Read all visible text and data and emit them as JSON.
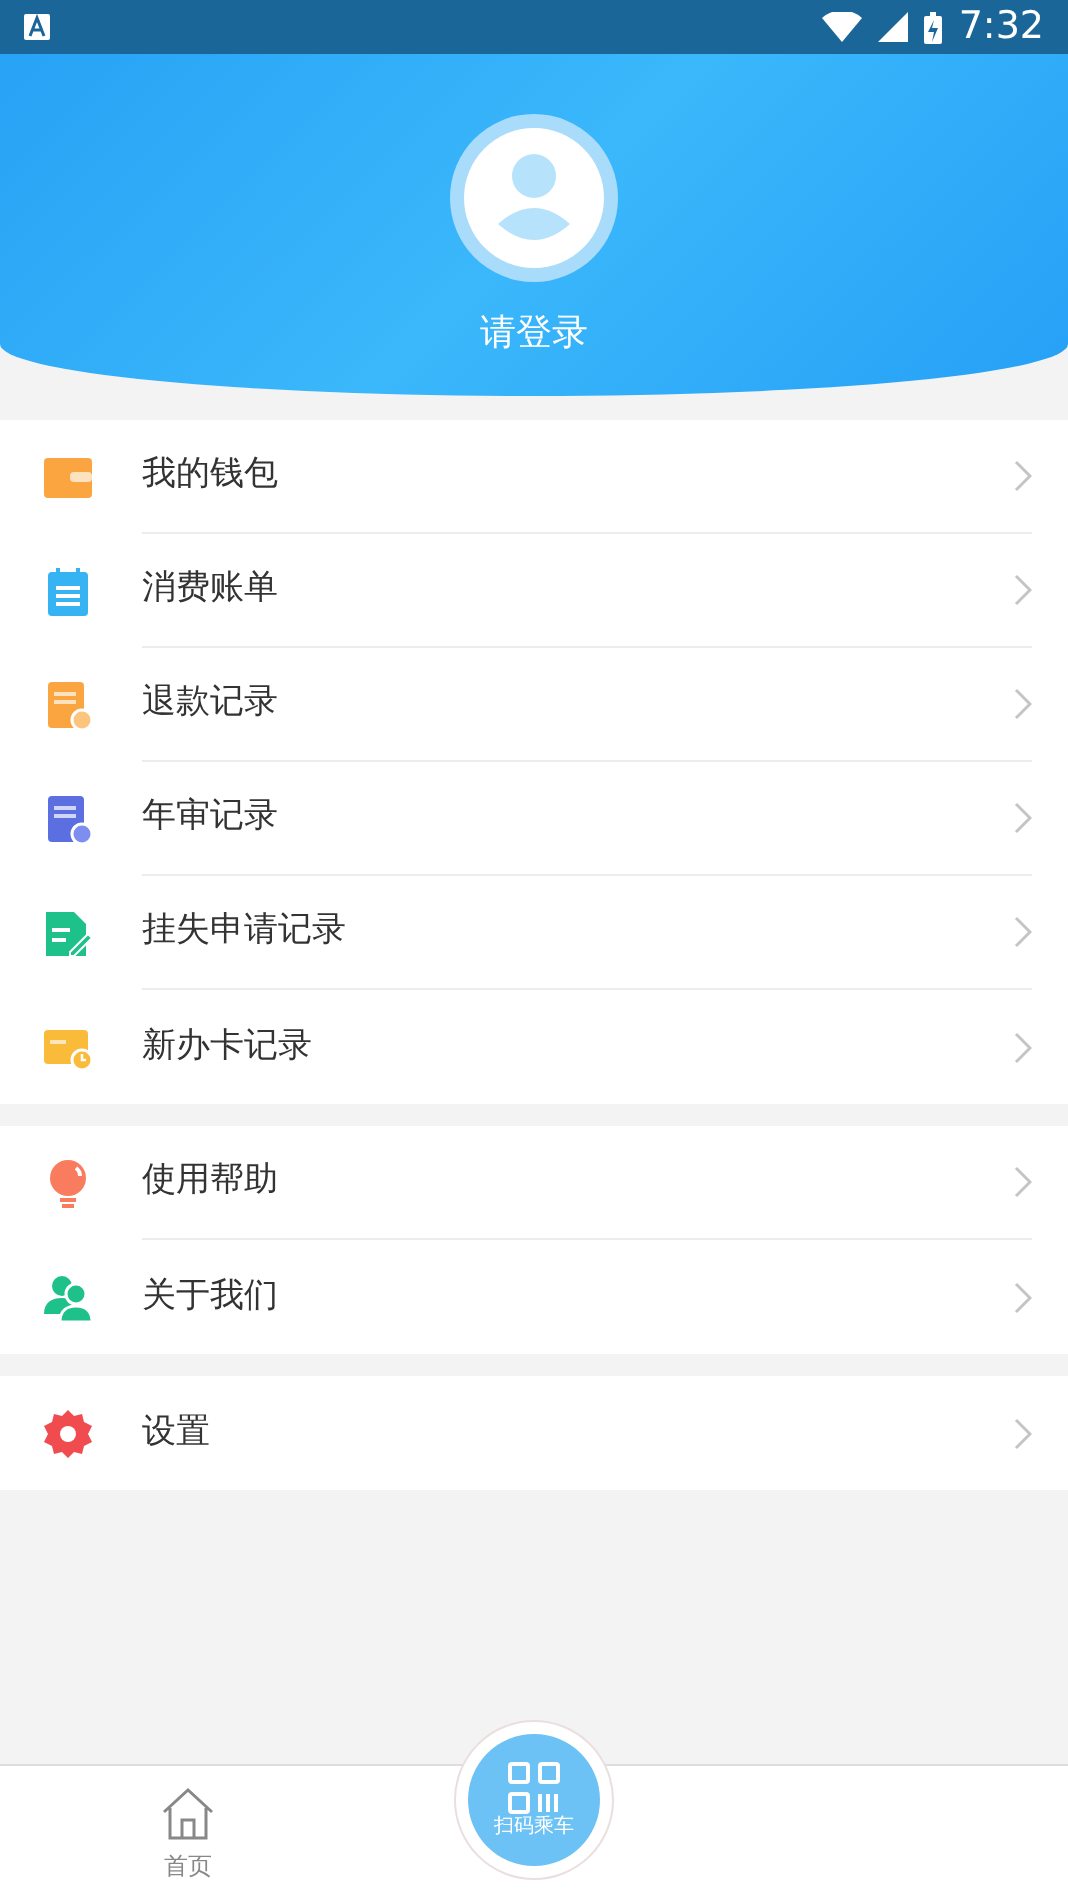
{
  "status_bar": {
    "time": "7:32"
  },
  "profile": {
    "login_label": "请登录"
  },
  "menu_groups": [
    {
      "items": [
        {
          "kind": "wallet",
          "label": "我的钱包"
        },
        {
          "kind": "bill",
          "label": "消费账单"
        },
        {
          "kind": "refund",
          "label": "退款记录"
        },
        {
          "kind": "review",
          "label": "年审记录"
        },
        {
          "kind": "loss",
          "label": "挂失申请记录"
        },
        {
          "kind": "newcard",
          "label": "新办卡记录"
        }
      ]
    },
    {
      "items": [
        {
          "kind": "help",
          "label": "使用帮助"
        },
        {
          "kind": "about",
          "label": "关于我们"
        }
      ]
    },
    {
      "items": [
        {
          "kind": "settings",
          "label": "设置"
        }
      ]
    }
  ],
  "bottom_nav": {
    "tabs": [
      {
        "label": "首页",
        "selected": false
      }
    ],
    "scan_button": {
      "label": "扫码乘车"
    }
  }
}
